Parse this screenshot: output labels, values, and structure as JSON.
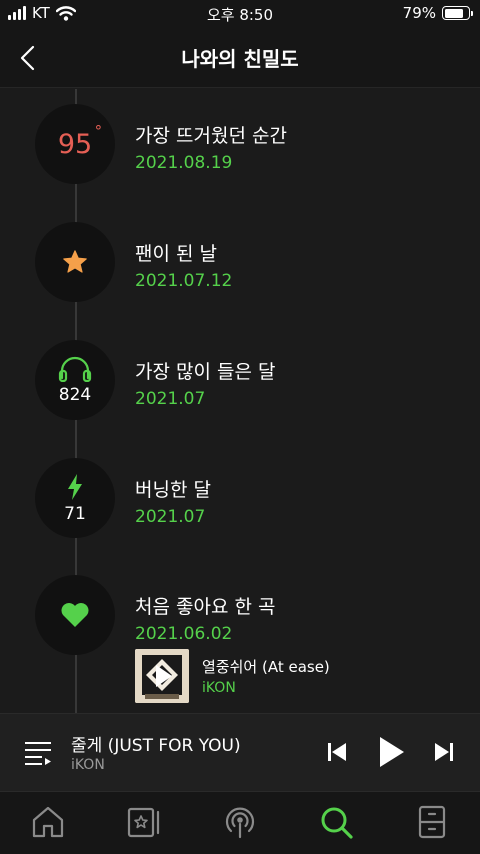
{
  "status_bar": {
    "carrier": "KT",
    "time": "오후 8:50",
    "battery": "79%",
    "battery_level": 0.79
  },
  "header": {
    "title": "나와의 친밀도"
  },
  "timeline": [
    {
      "badge_value": "95",
      "badge_unit": "°",
      "title": "가장 뜨거웠던 순간",
      "date": "2021.08.19",
      "icon": "temperature"
    },
    {
      "title": "팬이 된 날",
      "date": "2021.07.12",
      "icon": "star-icon"
    },
    {
      "badge_value": "824",
      "title": "가장 많이 들은 달",
      "date": "2021.07",
      "icon": "headphones-icon"
    },
    {
      "badge_value": "71",
      "title": "버닝한 달",
      "date": "2021.07",
      "icon": "lightning-icon"
    },
    {
      "title": "처음 좋아요 한 곡",
      "date": "2021.06.02",
      "icon": "heart-icon"
    }
  ],
  "first_liked_song": {
    "title": "열중쉬어 (At ease)",
    "artist": "iKON"
  },
  "player": {
    "title": "줄게 (JUST FOR YOU)",
    "artist": "iKON"
  },
  "tabs": [
    "home-icon",
    "library-icon",
    "podcast-icon",
    "search-icon",
    "storage-icon"
  ],
  "colors": {
    "accent": "#55d14b",
    "temperature": "#e55f55",
    "star": "#f5a04a",
    "background": "#1b1b1b"
  }
}
